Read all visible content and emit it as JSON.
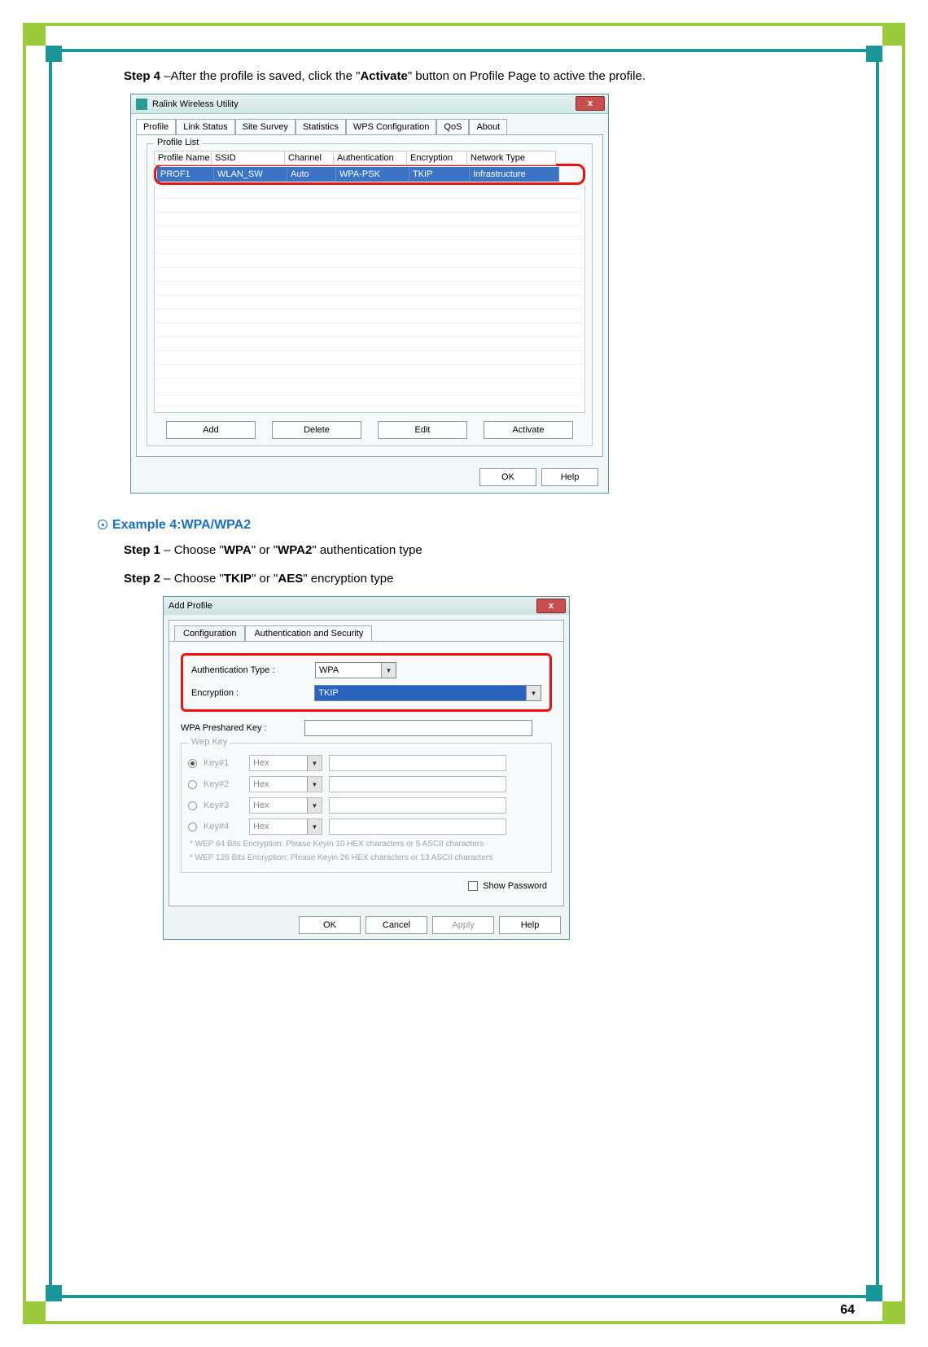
{
  "page_number": "64",
  "step4_label": "Step 4",
  "step4_text_a": " –After the profile is saved, click the \"",
  "step4_bold": "Activate",
  "step4_text_b": "\" button on Profile Page to active the profile.",
  "win1": {
    "title": "Ralink Wireless Utility",
    "close": "x",
    "tabs": [
      "Profile",
      "Link Status",
      "Site Survey",
      "Statistics",
      "WPS Configuration",
      "QoS",
      "About"
    ],
    "group_label": "Profile List",
    "headers": [
      "Profile Name",
      "SSID",
      "Channel",
      "Authentication",
      "Encryption",
      "Network Type"
    ],
    "row": [
      "PROF1",
      "WLAN_SW",
      "Auto",
      "WPA-PSK",
      "TKIP",
      "Infrastructure"
    ],
    "buttons": [
      "Add",
      "Delete",
      "Edit",
      "Activate"
    ],
    "ok": "OK",
    "help": "Help"
  },
  "example_heading": "Example 4:WPA/WPA2",
  "step1_label": "Step 1",
  "step1_a": " – Choose \"",
  "step1_b1": "WPA",
  "step1_mid": "\" or \"",
  "step1_b2": "WPA2",
  "step1_end": "\" authentication type",
  "step2_label": "Step 2",
  "step2_a": " – Choose \"",
  "step2_b1": "TKIP",
  "step2_mid": "\" or \"",
  "step2_b2": "AES",
  "step2_end": "\" encryption type",
  "win2": {
    "title": "Add Profile",
    "close": "x",
    "tabs": [
      "Configuration",
      "Authentication and Security"
    ],
    "auth_label": "Authentication Type :",
    "auth_value": "WPA",
    "enc_label": "Encryption :",
    "enc_value": "TKIP",
    "psk_label": "WPA Preshared Key :",
    "wep_group": "Wep Key",
    "keys": [
      "Key#1",
      "Key#2",
      "Key#3",
      "Key#4"
    ],
    "hex": "Hex",
    "note1": "* WEP 64 Bits Encryption:  Please Keyin 10 HEX characters or 5 ASCII characters",
    "note2": "* WEP 128 Bits Encryption:  Please Keyin 26 HEX characters or 13 ASCII characters",
    "show_pw": "Show Password",
    "ok": "OK",
    "cancel": "Cancel",
    "apply": "Apply",
    "help": "Help"
  }
}
